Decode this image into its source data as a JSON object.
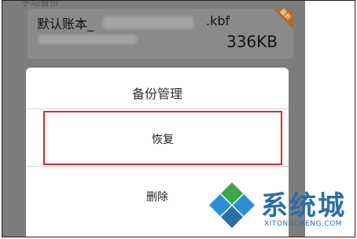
{
  "section": {
    "header": "手动备份"
  },
  "file": {
    "name_prefix": "默认账本_",
    "name_suffix": ".kbf",
    "size": "336KB",
    "badge": "最新"
  },
  "dialog": {
    "title": "备份管理",
    "options": [
      {
        "label": "恢复"
      },
      {
        "label": "删除"
      }
    ]
  },
  "watermark": {
    "text": "系统城",
    "url": "XITONGCHENG.COM"
  },
  "colors": {
    "highlight": "#e0262a",
    "watermark_blue": "#2c6da6",
    "watermark_green": "#3aa84a"
  }
}
